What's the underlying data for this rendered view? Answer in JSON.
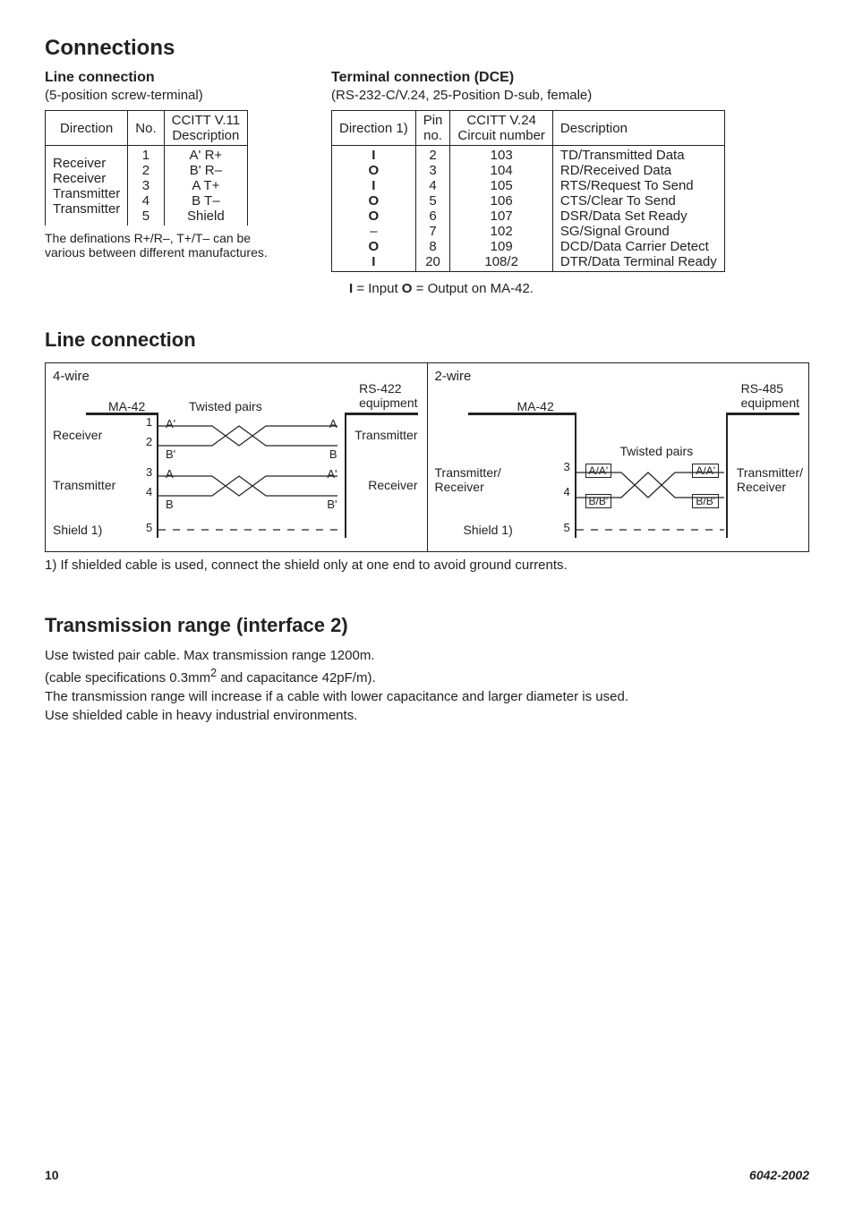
{
  "h_connections": "Connections",
  "h_line_conn": "Line connection",
  "h_line_conn_sub": "(5-position screw-terminal)",
  "h_terminal": "Terminal connection (DCE)",
  "h_terminal_sub": "(RS-232-C/V.24, 25-Position D-sub, female)",
  "t1": {
    "h_direction": "Direction",
    "h_no": "No.",
    "h_ccitt_l1": "CCITT V.11",
    "h_ccitt_l2": "Description",
    "rows": [
      {
        "d": "Receiver",
        "n": "1",
        "c": "A' R+"
      },
      {
        "d": "Receiver",
        "n": "2",
        "c": "B' R–"
      },
      {
        "d": "Transmitter",
        "n": "3",
        "c": "A  T+"
      },
      {
        "d": "Transmitter",
        "n": "4",
        "c": "B  T–"
      },
      {
        "d": "",
        "n": "5",
        "c": "Shield"
      }
    ],
    "note_l1": "The definations R+/R–, T+/T– can be",
    "note_l2": "various between different manufactures."
  },
  "t2": {
    "h_dir": "Direction 1)",
    "h_pin_l1": "Pin",
    "h_pin_l2": "no.",
    "h_ccitt_l1": "CCITT V.24",
    "h_ccitt_l2": "Circuit number",
    "h_desc": "Description",
    "rows": [
      {
        "d": "I",
        "p": "2",
        "c": "103",
        "desc": "TD/Transmitted Data"
      },
      {
        "d": "O",
        "p": "3",
        "c": "104",
        "desc": "RD/Received Data"
      },
      {
        "d": "I",
        "p": "4",
        "c": "105",
        "desc": "RTS/Request To Send"
      },
      {
        "d": "O",
        "p": "5",
        "c": "106",
        "desc": "CTS/Clear To Send"
      },
      {
        "d": "O",
        "p": "6",
        "c": "107",
        "desc": "DSR/Data Set Ready"
      },
      {
        "d": "–",
        "p": "7",
        "c": "102",
        "desc": "SG/Signal Ground"
      },
      {
        "d": "O",
        "p": "8",
        "c": "109",
        "desc": "DCD/Data Carrier Detect"
      },
      {
        "d": "I",
        "p": "20",
        "c": "108/2",
        "desc": "DTR/Data Terminal Ready"
      }
    ]
  },
  "io_legend_i": "I",
  "io_legend_eq_input": " = Input   ",
  "io_legend_o": "O",
  "io_legend_eq_output": " = Output on MA-42.",
  "h_line_connection2": "Line connection",
  "dia1": {
    "title": "4-wire",
    "ma": "MA-42",
    "tp": "Twisted pairs",
    "eq_l1": "RS-422",
    "eq_l2": "equipment",
    "rx": "Receiver",
    "tx": "Transmitter",
    "shield": "Shield 1)",
    "pins": {
      "1": "1",
      "2": "2",
      "3": "3",
      "4": "4",
      "5": "5"
    },
    "left_labels": {
      "a": "A'",
      "b": "B'",
      "a2": "A",
      "b2": "B"
    },
    "right_labels": {
      "a": "A",
      "b": "B",
      "a2": "A'",
      "b2": "B'"
    },
    "rx_r": "Transmitter",
    "tx_r": "Receiver"
  },
  "dia2": {
    "title": "2-wire",
    "ma": "MA-42",
    "tp": "Twisted pairs",
    "eq_l1": "RS-485",
    "eq_l2": "equipment",
    "txrx_l1": "Transmitter/",
    "txrx_l2": "Receiver",
    "shield": "Shield 1)",
    "pins": {
      "3": "3",
      "4": "4",
      "5": "5"
    },
    "left_labels": {
      "a": "A/A'",
      "b": "B/B'"
    },
    "right_labels": {
      "a": "A/A'",
      "b": "B/B'"
    }
  },
  "cable_note": "1) If shielded cable is used, connect the shield only at one end to avoid ground currents.",
  "h_trans": "Transmission range (interface 2)",
  "trans_p1": "Use twisted pair cable. Max transmission range 1200m.",
  "trans_p2a": "(cable specifications 0.3mm",
  "trans_p2b": " and capacitance 42pF/m).",
  "trans_p3": "The transmission range will increase if a cable with lower capacitance and larger diameter is used.",
  "trans_p4": "Use shielded cable in heavy industrial environments.",
  "footer_page": "10",
  "footer_doc": "6042-2002"
}
